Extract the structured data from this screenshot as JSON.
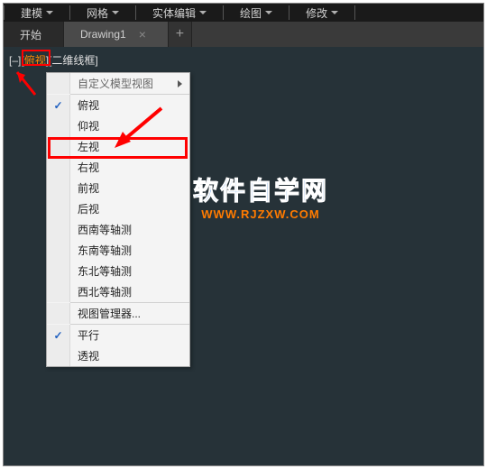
{
  "menubar": {
    "items": [
      "建模",
      "网格",
      "实体编辑",
      "绘图",
      "修改"
    ]
  },
  "tabs": {
    "start": "开始",
    "drawing": "Drawing1"
  },
  "viewport": {
    "prefix": "[–][",
    "hot": "俯视",
    "suffix": "][二维线框]"
  },
  "context_menu": {
    "header": "自定义模型视图",
    "views": [
      "俯视",
      "仰视",
      "左视",
      "右视",
      "前视",
      "后视",
      "西南等轴测",
      "东南等轴测",
      "东北等轴测",
      "西北等轴测"
    ],
    "checked_view_index": 0,
    "manager": "视图管理器...",
    "projection": [
      "平行",
      "透视"
    ],
    "checked_proj_index": 0
  },
  "watermark": {
    "main": "软件自学网",
    "sub": "WWW.RJZXW.COM"
  }
}
